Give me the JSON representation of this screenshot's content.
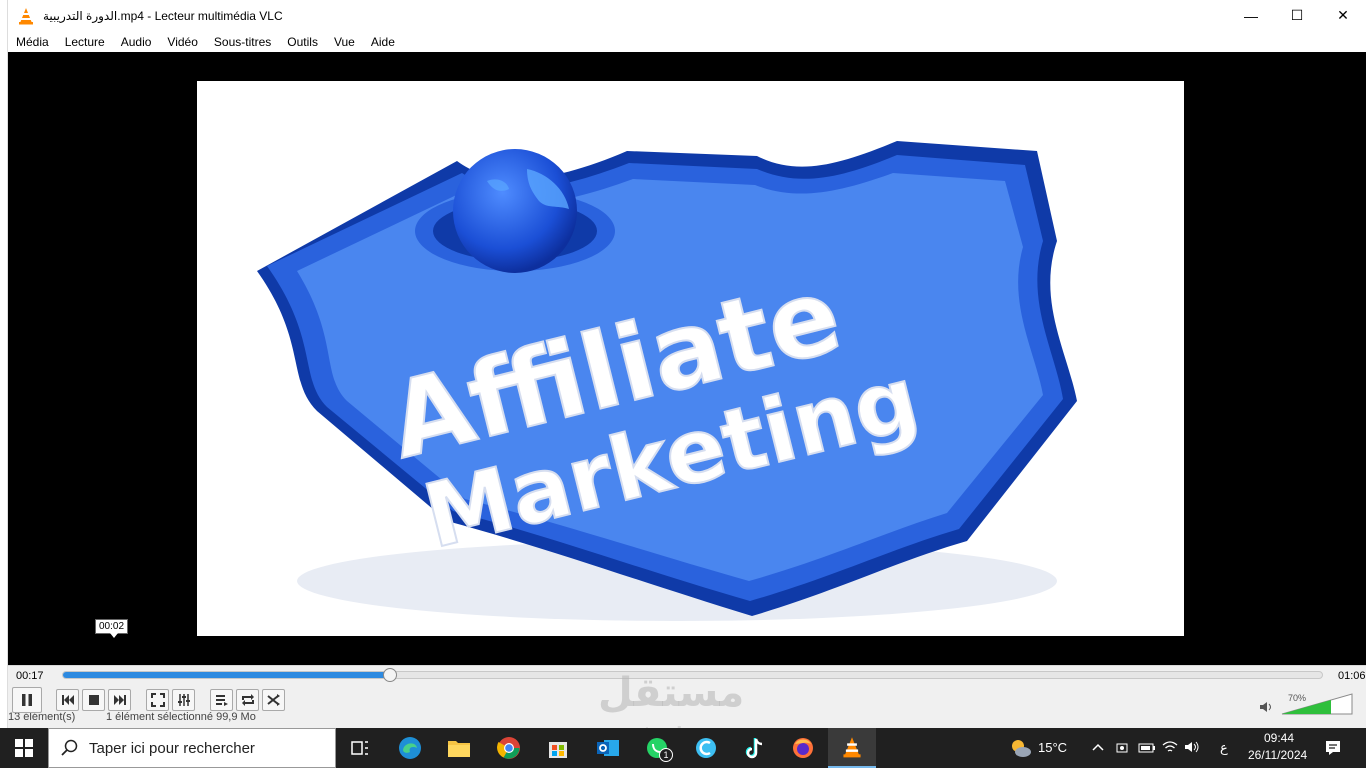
{
  "window": {
    "title": "الدورة التدريبية.mp4 - Lecteur multimédia VLC",
    "minimize_glyph": "—",
    "maximize_glyph": "☐",
    "close_glyph": "✕"
  },
  "menu": [
    "Média",
    "Lecture",
    "Audio",
    "Vidéo",
    "Sous-titres",
    "Outils",
    "Vue",
    "Aide"
  ],
  "video": {
    "frame_line1": "Affiliate",
    "frame_line2": "Marketing",
    "hover_time": "00:02"
  },
  "playback": {
    "elapsed": "00:17",
    "total": "01:06",
    "progress_fraction": 0.26,
    "volume_label": "70%",
    "volume_fraction": 0.7
  },
  "background_status": {
    "items_count": "13 élément(s)",
    "selected": "1 élément sélectionné  99,9 Mo"
  },
  "watermark": {
    "arabic": "مستقل",
    "latin": "mostaql.com"
  },
  "taskbar": {
    "search_placeholder": "Taper ici pour rechercher",
    "weather_temp": "15°C",
    "language": "ع",
    "time": "09:44",
    "date": "26/11/2024",
    "whatsapp_badge": "1"
  },
  "colors": {
    "accent": "#2d8ae0",
    "vlc_orange": "#ff8800",
    "taskbar": "#202020"
  },
  "icons": [
    "vlc-icon",
    "pause-icon",
    "previous-icon",
    "stop-icon",
    "next-icon",
    "fullscreen-icon",
    "extended-settings-icon",
    "playlist-icon",
    "loop-icon",
    "shuffle-icon",
    "volume-icon",
    "windows-start-icon",
    "search-icon",
    "task-view-icon",
    "edge-icon",
    "file-explorer-icon",
    "chrome-icon",
    "store-icon",
    "outlook-icon",
    "whatsapp-icon",
    "copilot-icon",
    "tiktok-icon",
    "firefox-icon",
    "vlc-taskbar-icon",
    "weather-icon",
    "chevron-up-icon",
    "meet-icon",
    "battery-icon",
    "wifi-icon",
    "speaker-icon",
    "notification-icon"
  ]
}
